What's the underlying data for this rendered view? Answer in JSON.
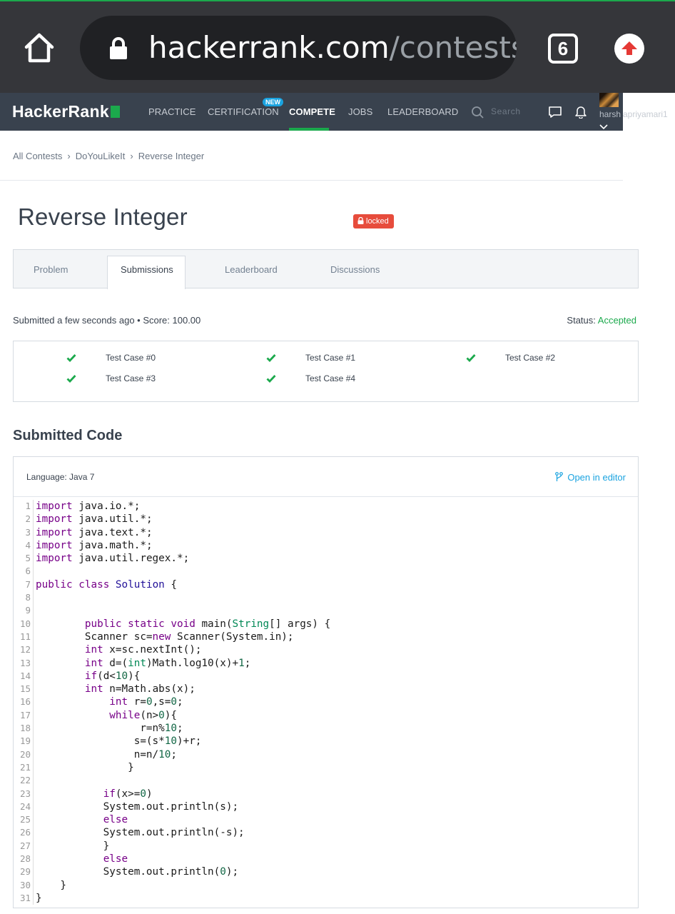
{
  "browser": {
    "url_host": "hackerrank.com",
    "url_path": "/contests/d",
    "tab_count": "6"
  },
  "nav": {
    "logo": "HackerRank",
    "items": [
      "PRACTICE",
      "CERTIFICATION",
      "COMPETE",
      "JOBS",
      "LEADERBOARD"
    ],
    "new_badge": "NEW",
    "search_placeholder": "Search",
    "username": "harshapriyamari1",
    "username_visible": "harsh",
    "username_overflow": "apriyamari1"
  },
  "breadcrumb": [
    "All Contests",
    "DoYouLikeIt",
    "Reverse Integer"
  ],
  "title": "Reverse Integer",
  "lock_badge": "locked",
  "tabs": [
    "Problem",
    "Submissions",
    "Leaderboard",
    "Discussions"
  ],
  "submission": {
    "info": "Submitted a few seconds ago • Score: 100.00",
    "status_label": "Status:",
    "status_value": "Accepted"
  },
  "test_cases": [
    "Test Case #0",
    "Test Case #1",
    "Test Case #2",
    "Test Case #3",
    "Test Case #4"
  ],
  "code_section": {
    "title": "Submitted Code",
    "language": "Language: Java 7",
    "open_editor": "Open in editor"
  },
  "code_lines": [
    "import java.io.*;",
    "import java.util.*;",
    "import java.text.*;",
    "import java.math.*;",
    "import java.util.regex.*;",
    "",
    "public class Solution {",
    "",
    "",
    "        public static void main(String[] args) {",
    "        Scanner sc=new Scanner(System.in);",
    "        int x=sc.nextInt();",
    "        int d=(int)Math.log10(x)+1;",
    "        if(d<10){",
    "        int n=Math.abs(x);",
    "            int r=0,s=0;",
    "            while(n>0){",
    "                 r=n%10;",
    "                s=(s*10)+r;",
    "                n=n/10;",
    "               }",
    "",
    "           if(x>=0)",
    "           System.out.println(s);",
    "           else",
    "           System.out.println(-s);",
    "           }",
    "           else",
    "           System.out.println(0);",
    "    }",
    "}"
  ]
}
